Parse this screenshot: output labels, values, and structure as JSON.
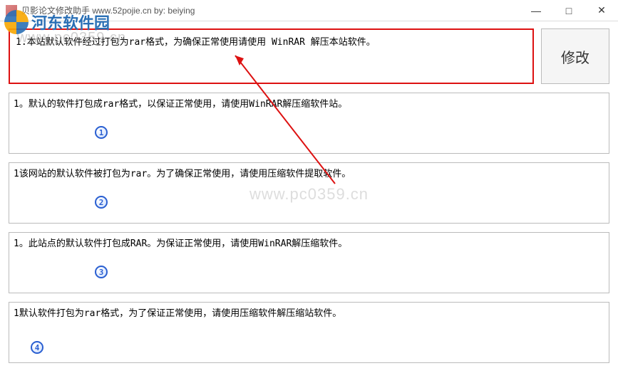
{
  "window": {
    "title": "贝影论文修改助手 www.52pojie.cn by: beiying"
  },
  "watermarks": {
    "logo_text": "河东软件园",
    "url_top": "www.pc0359.cn",
    "url_center": "www.pc0359.cn"
  },
  "input": {
    "text": "1.本站默认软件经过打包为rar格式，为确保正常使用请使用 WinRAR 解压本站软件。"
  },
  "buttons": {
    "modify": "修改"
  },
  "results": [
    {
      "num": "1",
      "text": "1。默认的软件打包成rar格式，以保证正常使用，请使用WinRAR解压缩软件站。"
    },
    {
      "num": "2",
      "text": "1该网站的默认软件被打包为rar。为了确保正常使用，请使用压缩软件提取软件。"
    },
    {
      "num": "3",
      "text": "1。此站点的默认软件打包成RAR。为保证正常使用，请使用WinRAR解压缩软件。"
    },
    {
      "num": "4",
      "text": "1默认软件打包为rar格式，为了保证正常使用，请使用压缩软件解压缩站软件。"
    }
  ],
  "window_controls": {
    "minimize": "—",
    "maximize": "□",
    "close": "✕"
  }
}
